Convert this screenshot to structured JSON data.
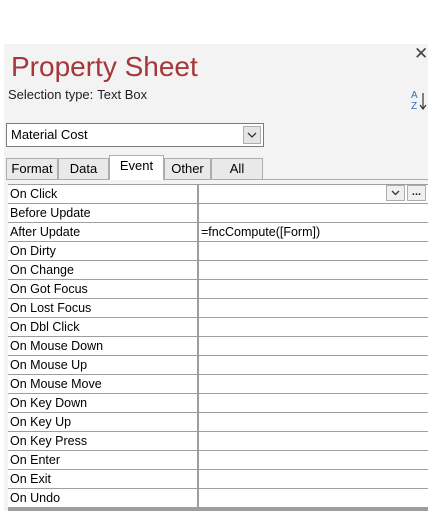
{
  "pane": {
    "title": "Property Sheet",
    "close_glyph": "✕",
    "selection_type_label": "Selection type:",
    "selection_type_value": "Text Box",
    "sort_icon": "sort-a-z-icon"
  },
  "object_selector": {
    "value": "Material Cost"
  },
  "tabs": [
    {
      "label": "Format",
      "active": false
    },
    {
      "label": "Data",
      "active": false
    },
    {
      "label": "Event",
      "active": true
    },
    {
      "label": "Other",
      "active": false
    },
    {
      "label": "All",
      "active": false
    }
  ],
  "properties": [
    {
      "name": "On Click",
      "value": ""
    },
    {
      "name": "Before Update",
      "value": ""
    },
    {
      "name": "After Update",
      "value": "=fncCompute([Form])"
    },
    {
      "name": "On Dirty",
      "value": ""
    },
    {
      "name": "On Change",
      "value": ""
    },
    {
      "name": "On Got Focus",
      "value": ""
    },
    {
      "name": "On Lost Focus",
      "value": ""
    },
    {
      "name": "On Dbl Click",
      "value": ""
    },
    {
      "name": "On Mouse Down",
      "value": ""
    },
    {
      "name": "On Mouse Up",
      "value": ""
    },
    {
      "name": "On Mouse Move",
      "value": ""
    },
    {
      "name": "On Key Down",
      "value": ""
    },
    {
      "name": "On Key Up",
      "value": ""
    },
    {
      "name": "On Key Press",
      "value": ""
    },
    {
      "name": "On Enter",
      "value": ""
    },
    {
      "name": "On Exit",
      "value": ""
    },
    {
      "name": "On Undo",
      "value": ""
    }
  ],
  "builder_button_label": "...",
  "colors": {
    "title": "#a4373a",
    "sort_icon": "#2e6fbd",
    "pane_background": "#f3f3f3",
    "grid_lines": "#9e9e9e"
  }
}
